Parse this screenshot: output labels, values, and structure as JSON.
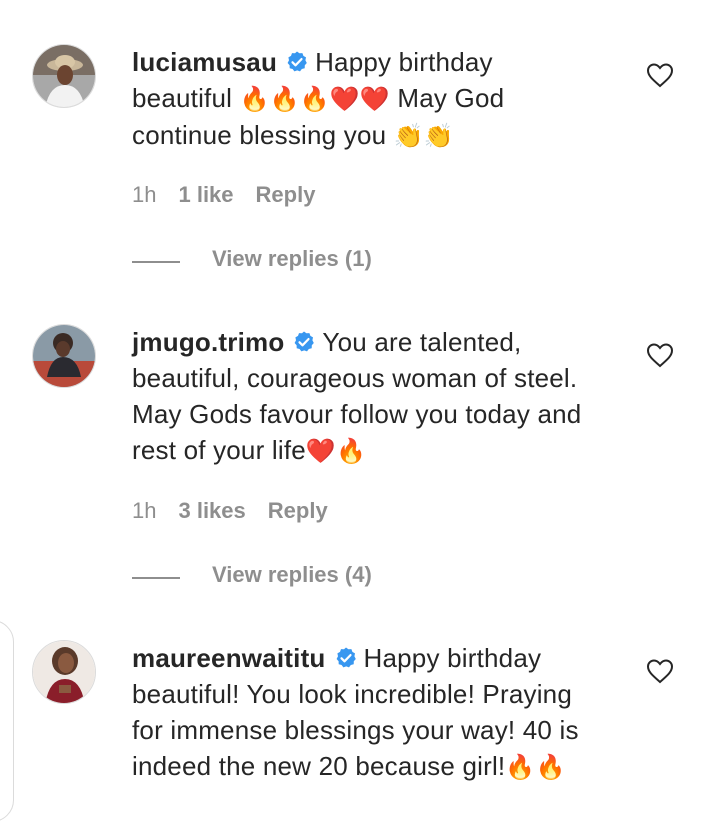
{
  "comments": [
    {
      "username": "luciamusau",
      "text": "Happy birthday beautiful 🔥🔥🔥❤️❤️ May God continue blessing you 👏👏",
      "text_parts": [
        "Happy birthday",
        "beautiful",
        "🔥🔥🔥❤️❤️",
        "May God",
        "continue blessing you",
        "👏👏"
      ],
      "time": "1h",
      "likes": "1 like",
      "reply_label": "Reply",
      "view_replies": "View replies (1)"
    },
    {
      "username": "jmugo.trimo",
      "text": "You are talented, beautiful, courageous woman of steel. May Gods favour follow you today and rest of your life❤️🔥",
      "text_parts": [
        "You are talented,",
        "beautiful, courageous woman of steel.",
        "May Gods favour follow you today and",
        "rest of your life",
        "❤️🔥"
      ],
      "time": "1h",
      "likes": "3 likes",
      "reply_label": "Reply",
      "view_replies": "View replies (4)"
    },
    {
      "username": "maureenwaititu",
      "text": "Happy birthday beautiful! You look incredible! Praying for immense blessings your way! 40 is indeed the new 20 because girl!🔥🔥",
      "text_parts": [
        "Happy birthday",
        "beautiful! You look incredible! Praying",
        "for immense blessings your way! 40 is",
        "indeed the new 20 because girl!",
        "🔥🔥"
      ]
    }
  ],
  "icons": {
    "verified": "verified-badge-icon",
    "heart": "heart-outline-icon"
  },
  "colors": {
    "verified": "#3897f0",
    "secondary_text": "#8e8e8e",
    "primary_text": "#262626"
  }
}
